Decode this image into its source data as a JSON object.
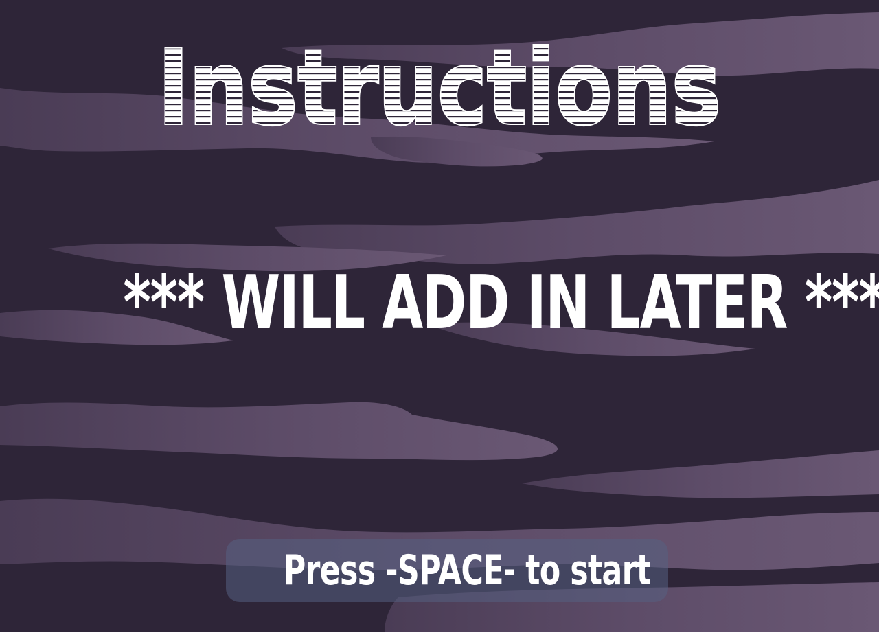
{
  "screen": {
    "title": "Instructions",
    "message": "*** WILL ADD IN LATER ***",
    "prompt": "Press -SPACE- to start"
  },
  "colors": {
    "background": "#2e2538",
    "wave": "#5a4a64",
    "wave_light": "#6d5b77",
    "text": "#ffffff",
    "prompt_panel": "#566082"
  }
}
